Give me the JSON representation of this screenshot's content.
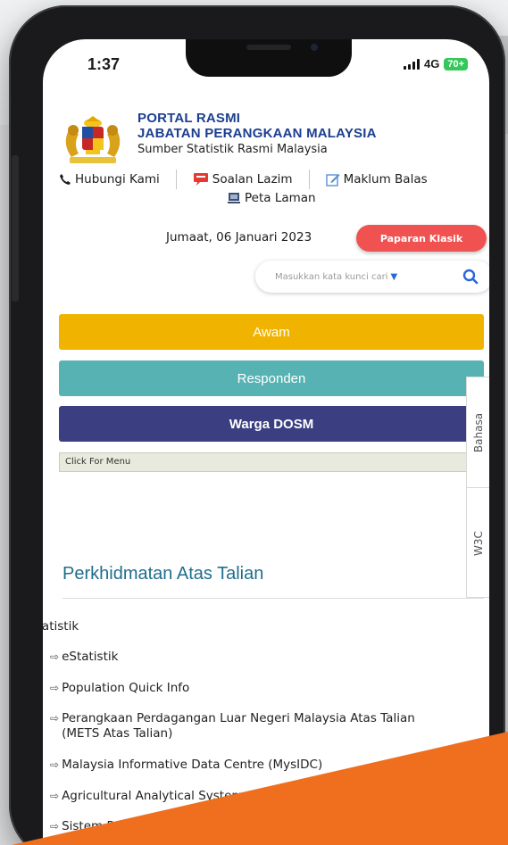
{
  "status": {
    "time": "1:37",
    "network": "4G",
    "battery": "70+"
  },
  "header": {
    "title_line1": "PORTAL RASMI",
    "title_line2": "JABATAN PERANGKAAN MALAYSIA",
    "subtitle": "Sumber Statistik Rasmi Malaysia"
  },
  "top_links": {
    "contact": "Hubungi Kami",
    "faq": "Soalan Lazim",
    "feedback": "Maklum Balas",
    "sitemap": "Peta Laman"
  },
  "date": "Jumaat, 06 Januari 2023",
  "classic_button": "Paparan Klasik",
  "search": {
    "placeholder": "Masukkan kata kunci cari"
  },
  "nav": {
    "awam": "Awam",
    "responden": "Responden",
    "warga": "Warga DOSM",
    "click_menu": "Click For Menu"
  },
  "side_tabs": {
    "language": "Bahasa",
    "w3c": "W3C"
  },
  "section": {
    "title": "Perkhidmatan Atas Talian",
    "items": [
      {
        "label": "Statistik"
      },
      {
        "label": "eStatistik"
      },
      {
        "label": "Population Quick Info"
      },
      {
        "label": "Perangkaan Perdagangan Luar Negeri Malaysia Atas Talian (METS Atas Talian)"
      },
      {
        "label": "Malaysia Informative Data Centre (MysIDC)"
      },
      {
        "label": "Agricultural Analytical System"
      },
      {
        "label": "Sistem Pemulihan Ekon"
      }
    ]
  },
  "colors": {
    "awam": "#f0b400",
    "responden": "#57b3b3",
    "warga": "#3b3f82",
    "classic": "#f05252",
    "accent": "#1f6e8c",
    "orange": "#ef6f1f"
  }
}
